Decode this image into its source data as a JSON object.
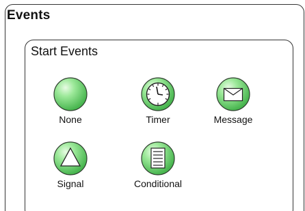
{
  "outer_group": {
    "title": "Events"
  },
  "inner_group": {
    "title": "Start Events"
  },
  "events": [
    {
      "label": "None",
      "icon": "none-icon"
    },
    {
      "label": "Timer",
      "icon": "clock-icon"
    },
    {
      "label": "Message",
      "icon": "envelope-icon"
    },
    {
      "label": "Signal",
      "icon": "triangle-icon"
    },
    {
      "label": "Conditional",
      "icon": "document-lines-icon"
    }
  ],
  "colors": {
    "node_fill_light": "#d7f6d2",
    "node_fill_main": "#86de86",
    "node_fill_dark": "#3fa84a",
    "node_stroke": "#2f3f2f",
    "frame_stroke": "#333333"
  }
}
